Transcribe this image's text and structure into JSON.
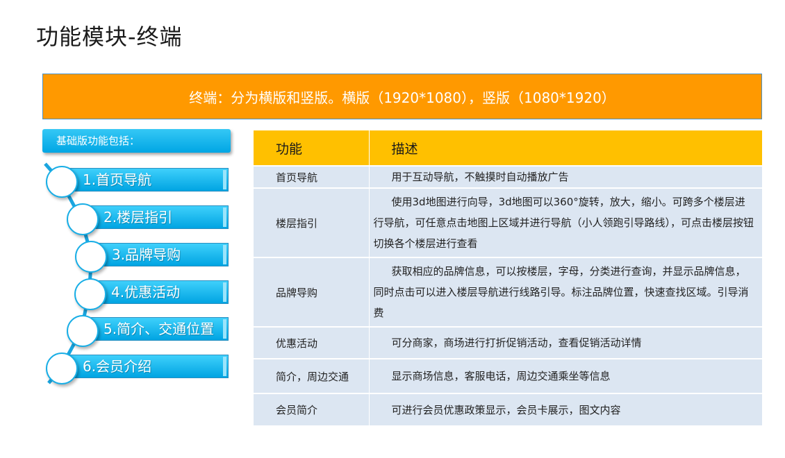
{
  "page": {
    "title": "功能模块-终端",
    "banner": "终端：分为横版和竖版。横版（1920*1080），竖版（1080*1920）",
    "subheading": "基础版功能包括："
  },
  "menu": [
    {
      "label": "1.首页导航"
    },
    {
      "label": "2.楼层指引"
    },
    {
      "label": "3.品牌导购"
    },
    {
      "label": "4.优惠活动"
    },
    {
      "label": "5.简介、交通位置"
    },
    {
      "label": "6.会员介绍"
    }
  ],
  "table": {
    "headers": [
      "功能",
      "描述"
    ],
    "rows": [
      {
        "feature": "首页导航",
        "desc": "用于互动导航，不触摸时自动播放广告"
      },
      {
        "feature": "楼层指引",
        "desc": "使用3d地图进行向导，3d地图可以360°旋转，放大，缩小。可跨多个楼层进行导航，可任意点击地图上区域并进行导航（小人领跑引导路线），可点击楼层按钮切换各个楼层进行查看"
      },
      {
        "feature": "品牌导购",
        "desc": "获取相应的品牌信息，可以按楼层，字母，分类进行查询，并显示品牌信息，同时点击可以进入楼层导航进行线路引导。标注品牌位置，快速查找区域。引导消费"
      },
      {
        "feature": "优惠活动",
        "desc": "可分商家，商场进行打折促销活动，查看促销活动详情"
      },
      {
        "feature": "简介，周边交通",
        "desc": "显示商场信息，客服电话，周边交通乘坐等信息"
      },
      {
        "feature": "会员简介",
        "desc": "可进行会员优惠政策显示，会员卡展示，图文内容"
      }
    ]
  },
  "colors": {
    "banner": "#ff9900",
    "accent_blue": "#00a6e4",
    "table_header": "#ffc000",
    "table_row": "#dce6f2"
  }
}
